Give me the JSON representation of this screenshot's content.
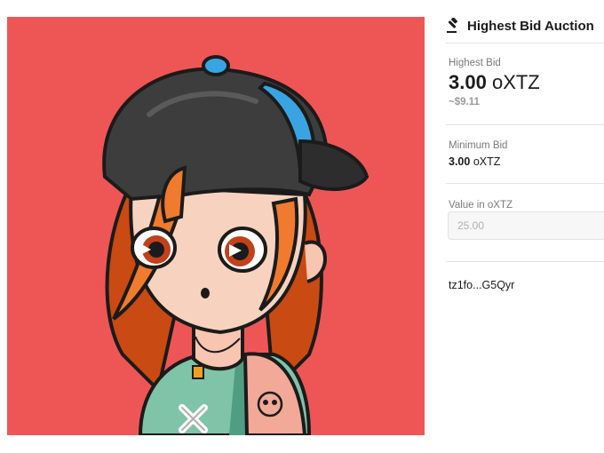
{
  "auction": {
    "title": "Highest Bid Auction",
    "highest_bid_label": "Highest Bid",
    "highest_bid_value": "3.00",
    "currency": "oXTZ",
    "highest_bid_usd": "~$9.11",
    "minimum_bid_label": "Minimum Bid",
    "minimum_bid_value": "3.00",
    "value_input_label": "Value in  oXTZ",
    "value_input_placeholder": "25.00",
    "seller_address": "tz1fo...G5Qyr"
  },
  "artwork": {
    "background_color": "#ee5656",
    "icon": "gavel-icon"
  }
}
